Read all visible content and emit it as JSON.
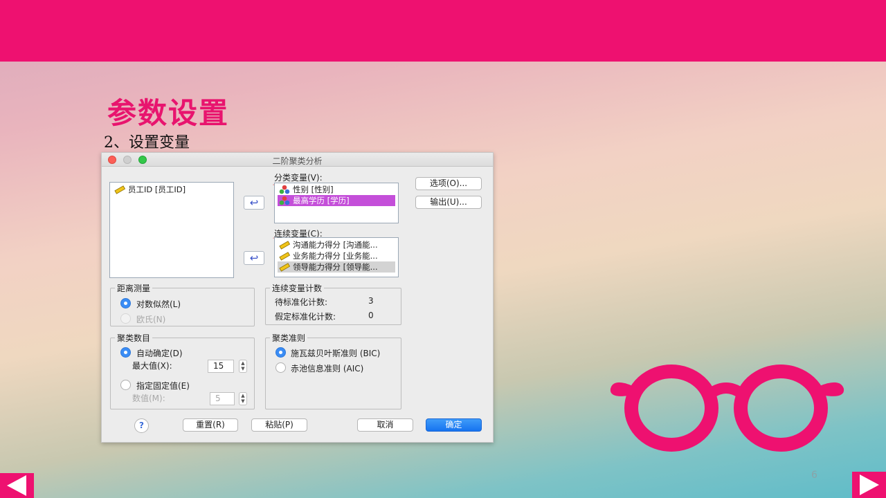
{
  "slide": {
    "title": "参数设置",
    "subtitle": "2、设置变量",
    "page_number": "6",
    "colors": {
      "accent": "#ee1170",
      "title": "#e8146e"
    }
  },
  "dialog": {
    "title": "二阶聚类分析",
    "source_list": [
      "员工ID [员工ID]"
    ],
    "categorical": {
      "label": "分类变量(V):",
      "items": [
        "性别 [性别]",
        "最高学历 [学历]"
      ]
    },
    "continuous": {
      "label": "连续变量(C):",
      "items": [
        "沟通能力得分 [沟通能...",
        "业务能力得分 [业务能...",
        "领导能力得分 [领导能..."
      ]
    },
    "side_buttons": {
      "options": "选项(O)...",
      "output": "输出(U)..."
    },
    "distance": {
      "title": "距离测量",
      "option1": "对数似然(L)",
      "option2": "欧氏(N)",
      "selected": "对数似然(L)"
    },
    "cont_count": {
      "title": "连续变量计数",
      "row1_label": "待标准化计数:",
      "row1_value": "3",
      "row2_label": "假定标准化计数:",
      "row2_value": "0"
    },
    "num_clusters": {
      "title": "聚类数目",
      "auto_label": "自动确定(D)",
      "max_label": "最大值(X):",
      "max_value": "15",
      "fixed_label": "指定固定值(E)",
      "num_label": "数值(M):",
      "num_value": "5",
      "selected": "自动确定(D)"
    },
    "criterion": {
      "title": "聚类准则",
      "option1": "施瓦兹贝叶斯准则 (BIC)",
      "option2": "赤池信息准则 (AIC)",
      "selected": "施瓦兹贝叶斯准则 (BIC)"
    },
    "footer": {
      "help": "?",
      "reset": "重置(R)",
      "paste": "粘贴(P)",
      "cancel": "取消",
      "ok": "确定"
    }
  }
}
